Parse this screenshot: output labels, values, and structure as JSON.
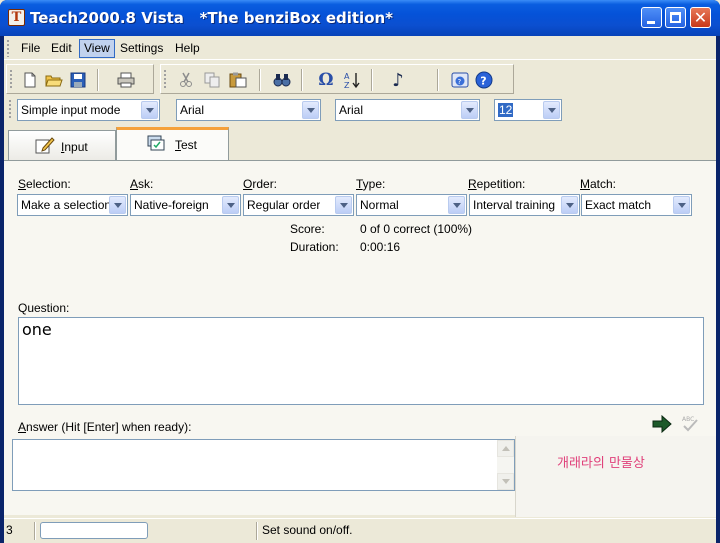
{
  "window": {
    "title": "Teach2000.8 Vista   *The benziBox edition*",
    "app_icon_letter": "T"
  },
  "menu": {
    "items": [
      "File",
      "Edit",
      "View",
      "Settings",
      "Help"
    ],
    "active": "View"
  },
  "format_bar": {
    "mode": "Simple input mode",
    "font1": "Arial",
    "font2": "Arial",
    "size": "12"
  },
  "tabs": [
    {
      "label": "Input",
      "mnemonic": "I",
      "rest": "nput"
    },
    {
      "label": "Test",
      "mnemonic": "T",
      "rest": "est"
    }
  ],
  "settings": {
    "selection": {
      "label_m": "S",
      "label_rest": "election:",
      "value": "Make a selection"
    },
    "ask": {
      "label_m": "A",
      "label_rest": "sk:",
      "value": "Native-foreign"
    },
    "order": {
      "label_m": "O",
      "label_rest": "rder:",
      "value": "Regular order"
    },
    "type": {
      "label_m": "T",
      "label_rest": "ype:",
      "value": "Normal"
    },
    "repetition": {
      "label_m": "R",
      "label_rest": "epetition:",
      "value": "Interval training"
    },
    "match": {
      "label_m": "M",
      "label_rest": "atch:",
      "value": "Exact match"
    }
  },
  "stats": {
    "score_label": "Score:",
    "score_value": "0 of 0 correct (100%)",
    "duration_label": "Duration:",
    "duration_value": "0:00:16"
  },
  "question": {
    "label": "Question:",
    "text": "one"
  },
  "answer": {
    "label_m": "A",
    "label_rest": "nswer (Hit [Enter] when ready):",
    "value": ""
  },
  "side_text": "개래라의 만물상",
  "status": {
    "count": "3",
    "message": "Set sound on/off."
  },
  "colors": {
    "title_blue": "#0552d8",
    "tab_accent": "#f5a13a",
    "korean_text": "#e0407a"
  }
}
